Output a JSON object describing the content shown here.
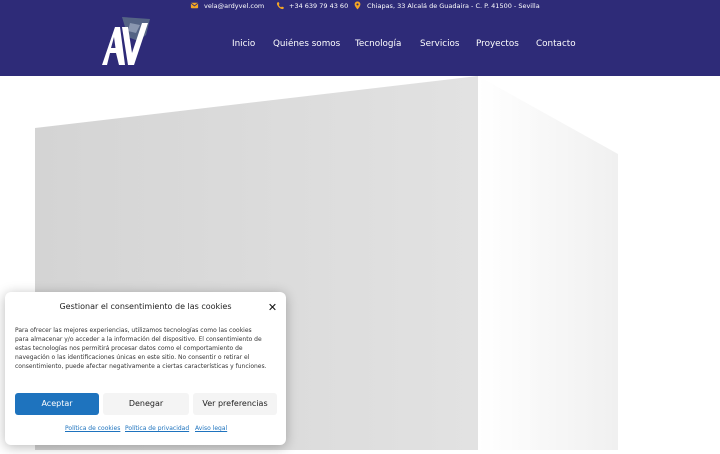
{
  "topbar": {
    "email": "vela@ardyvel.com",
    "phone": "+34 639 79 43 60",
    "address": "Chiapas, 33 Alcalá de Guadaira - C. P. 41500 - Sevilla"
  },
  "logo": {
    "text": "AV"
  },
  "nav": {
    "items": [
      {
        "label": "Inicio"
      },
      {
        "label": "Quiénes somos"
      },
      {
        "label": "Tecnología"
      },
      {
        "label": "Servicios"
      },
      {
        "label": "Proyectos"
      },
      {
        "label": "Contacto"
      }
    ]
  },
  "slider": {
    "prev_glyph": "‹"
  },
  "cookie": {
    "title": "Gestionar el consentimiento de las cookies",
    "close_glyph": "✕",
    "body": "Para ofrecer las mejores experiencias, utilizamos tecnologías como las cookies para almacenar y/o acceder a la información del dispositivo. El consentimiento de estas tecnologías nos permitirá procesar datos como el comportamiento de navegación o las identificaciones únicas en este sitio. No consentir o retirar el consentimiento, puede afectar negativamente a ciertas características y funciones.",
    "buttons": {
      "accept": "Aceptar",
      "deny": "Denegar",
      "preferences": "Ver preferencias"
    },
    "links": [
      {
        "label": "Política de cookies"
      },
      {
        "label": "Política de privacidad"
      },
      {
        "label": "Aviso legal"
      }
    ]
  },
  "colors": {
    "header_bg": "#2e2b78",
    "accent_orange": "#f5a623",
    "accept_blue": "#1e73be"
  },
  "icons": {
    "email": "envelope-icon",
    "phone": "phone-icon",
    "address": "map-pin-icon",
    "close": "close-icon",
    "prev": "chevron-left-icon"
  }
}
